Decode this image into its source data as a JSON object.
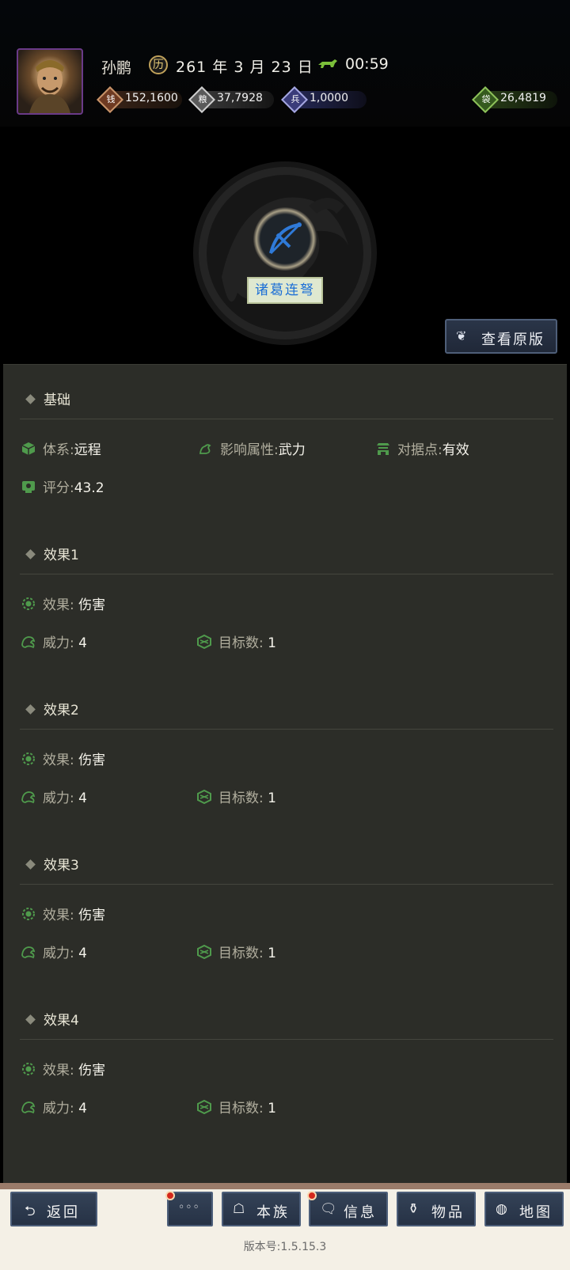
{
  "header": {
    "player_name": "孙鹏",
    "date": "261 年 3 月 23 日",
    "clock": "00:59",
    "resources": [
      {
        "name": "gold-icon",
        "value": "152,1600",
        "color": "#6e3a22"
      },
      {
        "name": "grain-icon",
        "value": "37,7928",
        "color": "#5a5a5a"
      },
      {
        "name": "troops-icon",
        "value": "1,0000",
        "color": "#3a3c7a"
      },
      {
        "name": "jade-icon",
        "value": "26,4819",
        "color": "#355a1e"
      }
    ]
  },
  "weapon": {
    "name": "诸葛连弩",
    "view_button": "查看原版"
  },
  "basic": {
    "title": "基础",
    "attrs": [
      {
        "key": "体系:",
        "value": "远程",
        "icon": "cube-icon"
      },
      {
        "key": "影响属性:",
        "value": "武力",
        "icon": "arm-icon"
      },
      {
        "key": "对据点:",
        "value": "有效",
        "icon": "fort-icon"
      },
      {
        "key": "评分:",
        "value": "43.2",
        "icon": "score-icon"
      }
    ]
  },
  "effects": [
    {
      "title": "效果1",
      "effect_key": "效果:",
      "effect_value": "伤害",
      "power_key": "威力:",
      "power_value": "4",
      "targets_key": "目标数:",
      "targets_value": "1"
    },
    {
      "title": "效果2",
      "effect_key": "效果:",
      "effect_value": "伤害",
      "power_key": "威力:",
      "power_value": "4",
      "targets_key": "目标数:",
      "targets_value": "1"
    },
    {
      "title": "效果3",
      "effect_key": "效果:",
      "effect_value": "伤害",
      "power_key": "威力:",
      "power_value": "4",
      "targets_key": "目标数:",
      "targets_value": "1"
    },
    {
      "title": "效果4",
      "effect_key": "效果:",
      "effect_value": "伤害",
      "power_key": "威力:",
      "power_value": "4",
      "targets_key": "目标数:",
      "targets_value": "1"
    }
  ],
  "nav": {
    "back": "返回",
    "more": "◦◦◦",
    "clan": "本族",
    "info": "信息",
    "items": "物品",
    "map": "地图"
  },
  "version": "版本号:1.5.15.3"
}
